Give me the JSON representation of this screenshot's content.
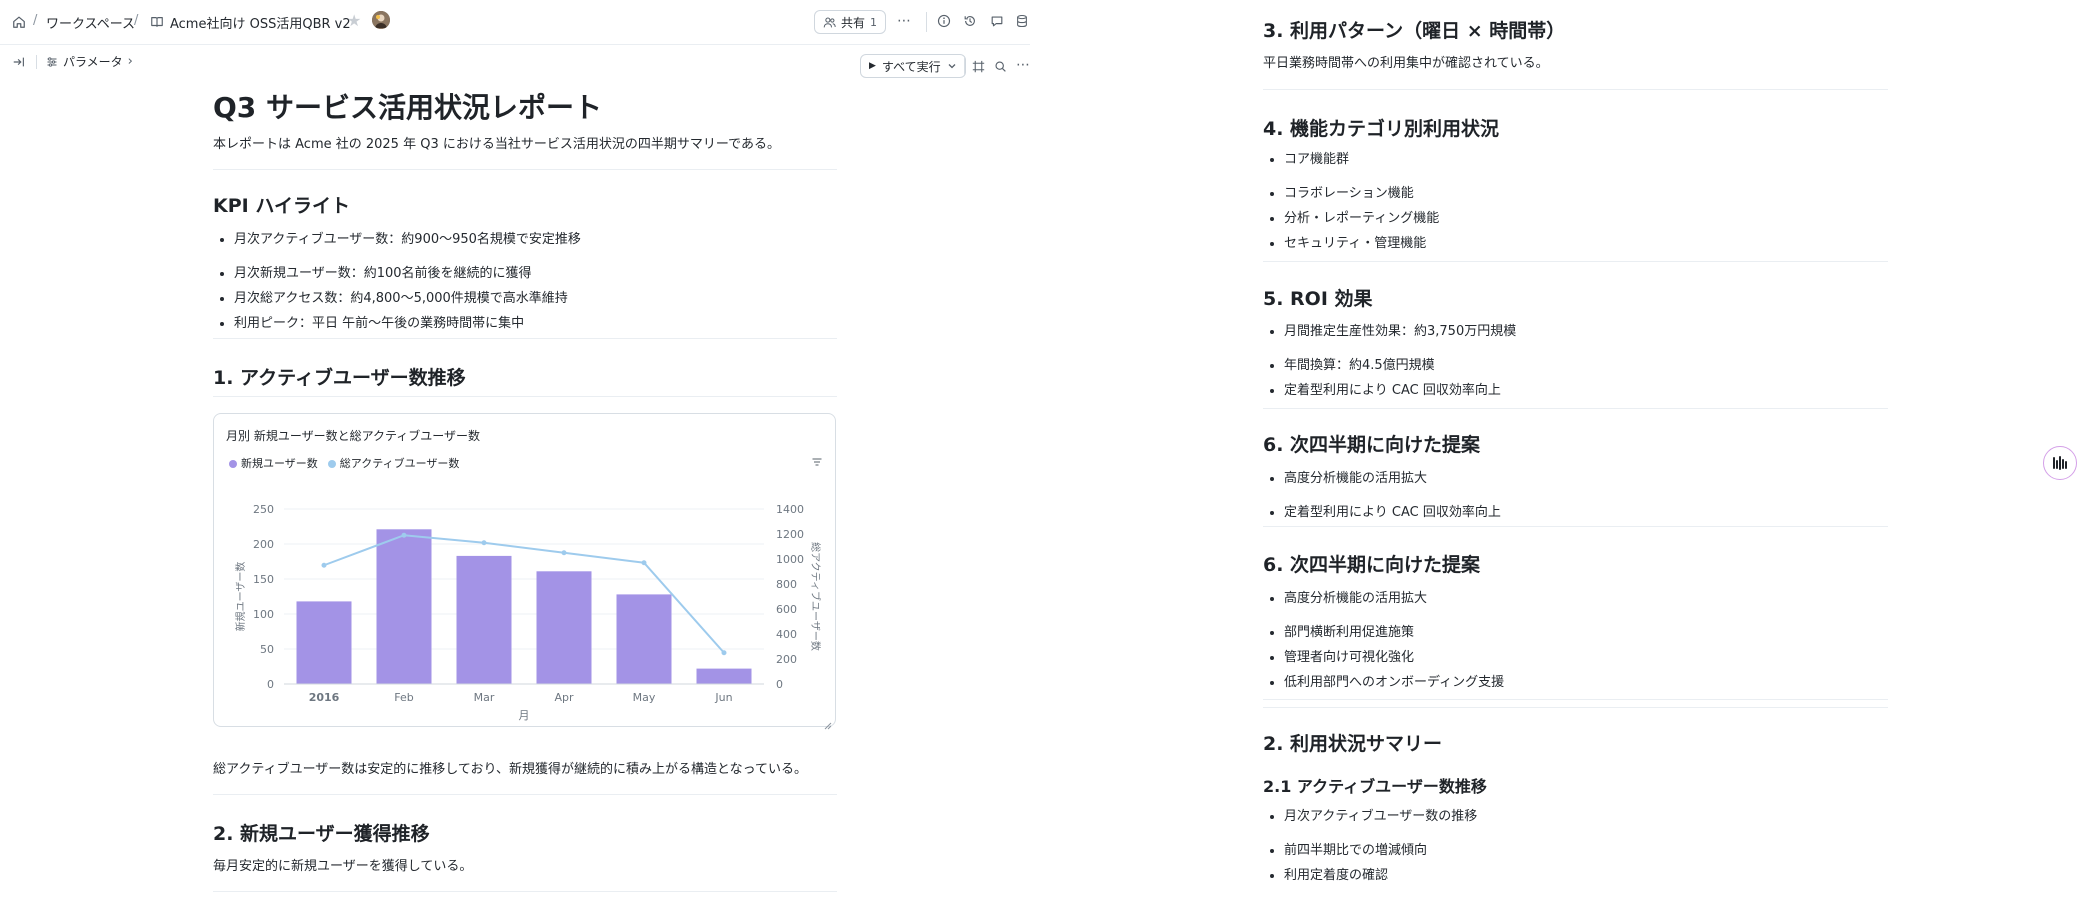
{
  "topbar": {
    "breadcrumb_workspace": "ワークスペース",
    "doc_name": "Acme社向け OSS活用QBR v2",
    "share_label": "共有",
    "share_count": "1"
  },
  "subbar": {
    "params_label": "パラメータ",
    "run_all_label": "すべて実行"
  },
  "doc": {
    "title": "Q3 サービス活用状況レポート",
    "intro": "本レポートは Acme 社の 2025 年 Q3 における当社サービス活用状況の四半期サマリーである。",
    "kpi_heading": "KPI ハイライト",
    "kpi_items": [
      "月次アクティブユーザー数：約900〜950名規模で安定推移",
      "月次新規ユーザー数：約100名前後を継続的に獲得",
      "月次総アクセス数：約4,800〜5,000件規模で高水準維持",
      "利用ピーク：平日 午前〜午後の業務時間帯に集中"
    ],
    "s1_heading": "1. アクティブユーザー数推移",
    "s1_note": "総アクティブユーザー数は安定的に推移しており、新規獲得が継続的に積み上がる構造となっている。",
    "s2_heading": "2. 新規ユーザー獲得推移",
    "s2_note": "毎月安定的に新規ユーザーを獲得している。"
  },
  "chart_data": {
    "type": "bar+line",
    "title": "月別 新規ユーザー数と総アクティブユーザー数",
    "categories": [
      "2016",
      "Feb",
      "Mar",
      "Apr",
      "May",
      "Jun"
    ],
    "xlabel": "月",
    "ylabel_left": "新規ユーザー数",
    "ylabel_right": "総アクティブユーザー数",
    "ylim_left": [
      0,
      250
    ],
    "yticks_left": [
      "0",
      "50",
      "100",
      "150",
      "200",
      "250"
    ],
    "ylim_right": [
      0,
      1400
    ],
    "yticks_right": [
      "0",
      "200",
      "400",
      "600",
      "800",
      "1000",
      "1200",
      "1400"
    ],
    "series": [
      {
        "name": "新規ユーザー数",
        "type": "bar",
        "axis": "left",
        "color": "#a393e6",
        "values": [
          118,
          221,
          183,
          161,
          128,
          22
        ]
      },
      {
        "name": "総アクティブユーザー数",
        "type": "line",
        "axis": "right",
        "color": "#9ecbed",
        "values": [
          950,
          1190,
          1130,
          1050,
          970,
          250
        ]
      }
    ],
    "legend": "top-left",
    "grid": true
  },
  "right": {
    "s3_heading": "3. 利用パターン（曜日 × 時間帯）",
    "s3_note": "平日業務時間帯への利用集中が確認されている。",
    "s4_heading": "4. 機能カテゴリ別利用状況",
    "s4_items": [
      "コア機能群",
      "コラボレーション機能",
      "分析・レポーティング機能",
      "セキュリティ・管理機能"
    ],
    "s5_heading": "5. ROI 効果",
    "s5_items": [
      "月間推定生産性効果：約3,750万円規模",
      "年間換算：約4.5億円規模",
      "定着型利用により CAC 回収効率向上"
    ],
    "s6a_heading": "6. 次四半期に向けた提案",
    "s6a_items": [
      "高度分析機能の活用拡大",
      "定着型利用により CAC 回収効率向上"
    ],
    "s6b_heading": "6. 次四半期に向けた提案",
    "s6b_items": [
      "高度分析機能の活用拡大",
      "部門横断利用促進施策",
      "管理者向け可視化強化",
      "低利用部門へのオンボーディング支援"
    ],
    "s2_heading": "2. 利用状況サマリー",
    "s21_heading": "2.1 アクティブユーザー数推移",
    "s21_items": [
      "月次アクティブユーザー数の推移",
      "前四半期比での増減傾向",
      "利用定着度の確認"
    ]
  }
}
